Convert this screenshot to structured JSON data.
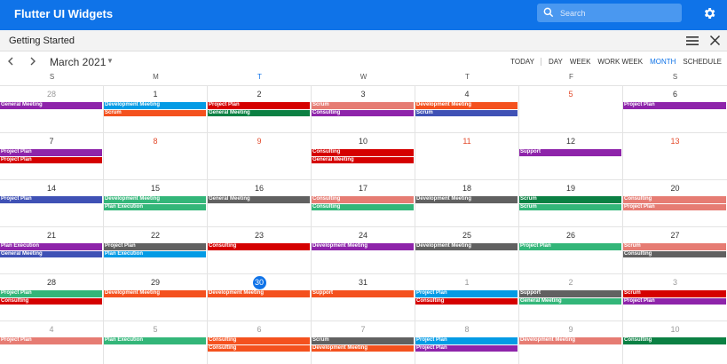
{
  "app": {
    "title": "Flutter UI Widgets",
    "search_placeholder": "Search"
  },
  "subheader": {
    "title": "Getting Started"
  },
  "calendar": {
    "month_label": "March 2021",
    "views": [
      "TODAY",
      "DAY",
      "WEEK",
      "WORK WEEK",
      "MONTH",
      "SCHEDULE"
    ],
    "active_view": "MONTH",
    "weekdays": [
      "S",
      "M",
      "T",
      "W",
      "T",
      "F",
      "S"
    ],
    "today_column": 2,
    "colors": {
      "purple": "#8e24aa",
      "blue": "#039be5",
      "indigo": "#3f51b5",
      "red": "#d50000",
      "green": "#0b8043",
      "orange": "#f4511e",
      "salmon": "#e67c73",
      "gray": "#616161",
      "teal": "#33b679"
    },
    "days": [
      {
        "n": "28",
        "style": "muted",
        "events": [
          {
            "t": "General Meeting",
            "c": "purple"
          }
        ]
      },
      {
        "n": "1",
        "style": "",
        "events": [
          {
            "t": "Development Meeting",
            "c": "blue"
          },
          {
            "t": "Scrum",
            "c": "orange"
          }
        ]
      },
      {
        "n": "2",
        "style": "",
        "events": [
          {
            "t": "Project Plan",
            "c": "red"
          },
          {
            "t": "General Meeting",
            "c": "green"
          }
        ]
      },
      {
        "n": "3",
        "style": "",
        "events": [
          {
            "t": "Scrum",
            "c": "salmon"
          },
          {
            "t": "Consulting",
            "c": "purple"
          }
        ]
      },
      {
        "n": "4",
        "style": "",
        "events": [
          {
            "t": "Development Meeting",
            "c": "orange"
          },
          {
            "t": "Scrum",
            "c": "indigo"
          }
        ]
      },
      {
        "n": "5",
        "style": "weekend",
        "events": []
      },
      {
        "n": "6",
        "style": "",
        "events": [
          {
            "t": "Project Plan",
            "c": "purple"
          }
        ]
      },
      {
        "n": "7",
        "style": "",
        "events": [
          {
            "t": "Project Plan",
            "c": "purple"
          },
          {
            "t": "Project Plan",
            "c": "red"
          }
        ]
      },
      {
        "n": "8",
        "style": "weekend",
        "events": []
      },
      {
        "n": "9",
        "style": "weekend",
        "events": []
      },
      {
        "n": "10",
        "style": "",
        "events": [
          {
            "t": "Consulting",
            "c": "red"
          },
          {
            "t": "General Meeting",
            "c": "red"
          }
        ]
      },
      {
        "n": "11",
        "style": "weekend",
        "events": []
      },
      {
        "n": "12",
        "style": "",
        "events": [
          {
            "t": "Support",
            "c": "purple"
          }
        ]
      },
      {
        "n": "13",
        "style": "weekend",
        "events": []
      },
      {
        "n": "14",
        "style": "",
        "events": [
          {
            "t": "Project Plan",
            "c": "indigo"
          }
        ]
      },
      {
        "n": "15",
        "style": "",
        "events": [
          {
            "t": "Development Meeting",
            "c": "teal"
          },
          {
            "t": "Plan Execution",
            "c": "teal"
          }
        ]
      },
      {
        "n": "16",
        "style": "",
        "events": [
          {
            "t": "General Meeting",
            "c": "gray"
          }
        ]
      },
      {
        "n": "17",
        "style": "",
        "events": [
          {
            "t": "Consulting",
            "c": "salmon"
          },
          {
            "t": "Consulting",
            "c": "teal"
          }
        ]
      },
      {
        "n": "18",
        "style": "",
        "events": [
          {
            "t": "Development Meeting",
            "c": "gray"
          }
        ]
      },
      {
        "n": "19",
        "style": "",
        "events": [
          {
            "t": "Scrum",
            "c": "green"
          },
          {
            "t": "Scrum",
            "c": "teal"
          }
        ]
      },
      {
        "n": "20",
        "style": "",
        "events": [
          {
            "t": "Consulting",
            "c": "salmon"
          },
          {
            "t": "Project Plan",
            "c": "salmon"
          }
        ]
      },
      {
        "n": "21",
        "style": "",
        "events": [
          {
            "t": "Plan Execution",
            "c": "purple"
          },
          {
            "t": "General Meeting",
            "c": "indigo"
          }
        ]
      },
      {
        "n": "22",
        "style": "",
        "events": [
          {
            "t": "Project Plan",
            "c": "gray"
          },
          {
            "t": "Plan Execution",
            "c": "blue"
          }
        ]
      },
      {
        "n": "23",
        "style": "",
        "events": [
          {
            "t": "Consulting",
            "c": "red"
          }
        ]
      },
      {
        "n": "24",
        "style": "",
        "events": [
          {
            "t": "Development Meeting",
            "c": "purple"
          }
        ]
      },
      {
        "n": "25",
        "style": "",
        "events": [
          {
            "t": "Development Meeting",
            "c": "gray"
          }
        ]
      },
      {
        "n": "26",
        "style": "",
        "events": [
          {
            "t": "Project Plan",
            "c": "teal"
          }
        ]
      },
      {
        "n": "27",
        "style": "",
        "events": [
          {
            "t": "Scrum",
            "c": "salmon"
          },
          {
            "t": "Consulting",
            "c": "gray"
          }
        ]
      },
      {
        "n": "28",
        "style": "",
        "events": [
          {
            "t": "Project Plan",
            "c": "teal"
          },
          {
            "t": "Consulting",
            "c": "red"
          }
        ]
      },
      {
        "n": "29",
        "style": "",
        "events": [
          {
            "t": "Development Meeting",
            "c": "orange"
          }
        ]
      },
      {
        "n": "30",
        "style": "today",
        "events": [
          {
            "t": "Development Meeting",
            "c": "orange"
          }
        ]
      },
      {
        "n": "31",
        "style": "",
        "events": [
          {
            "t": "Support",
            "c": "orange"
          }
        ]
      },
      {
        "n": "1",
        "style": "muted",
        "events": [
          {
            "t": "Project Plan",
            "c": "blue"
          },
          {
            "t": "Consulting",
            "c": "red"
          }
        ]
      },
      {
        "n": "2",
        "style": "muted",
        "events": [
          {
            "t": "Support",
            "c": "gray"
          },
          {
            "t": "General Meeting",
            "c": "teal"
          }
        ]
      },
      {
        "n": "3",
        "style": "muted",
        "events": [
          {
            "t": "Scrum",
            "c": "red"
          },
          {
            "t": "Project Plan",
            "c": "purple"
          }
        ]
      },
      {
        "n": "4",
        "style": "muted",
        "events": [
          {
            "t": "Project Plan",
            "c": "salmon"
          }
        ]
      },
      {
        "n": "5",
        "style": "muted",
        "events": [
          {
            "t": "Plan Execution",
            "c": "teal"
          }
        ]
      },
      {
        "n": "6",
        "style": "muted",
        "events": [
          {
            "t": "Consulting",
            "c": "orange"
          },
          {
            "t": "Consulting",
            "c": "orange"
          }
        ]
      },
      {
        "n": "7",
        "style": "muted",
        "events": [
          {
            "t": "Scrum",
            "c": "gray"
          },
          {
            "t": "Development Meeting",
            "c": "orange"
          }
        ]
      },
      {
        "n": "8",
        "style": "muted",
        "events": [
          {
            "t": "Project Plan",
            "c": "blue"
          },
          {
            "t": "Project Plan",
            "c": "purple"
          }
        ]
      },
      {
        "n": "9",
        "style": "muted",
        "events": [
          {
            "t": "Development Meeting",
            "c": "salmon"
          }
        ]
      },
      {
        "n": "10",
        "style": "muted",
        "events": [
          {
            "t": "Consulting",
            "c": "green"
          }
        ]
      }
    ]
  }
}
